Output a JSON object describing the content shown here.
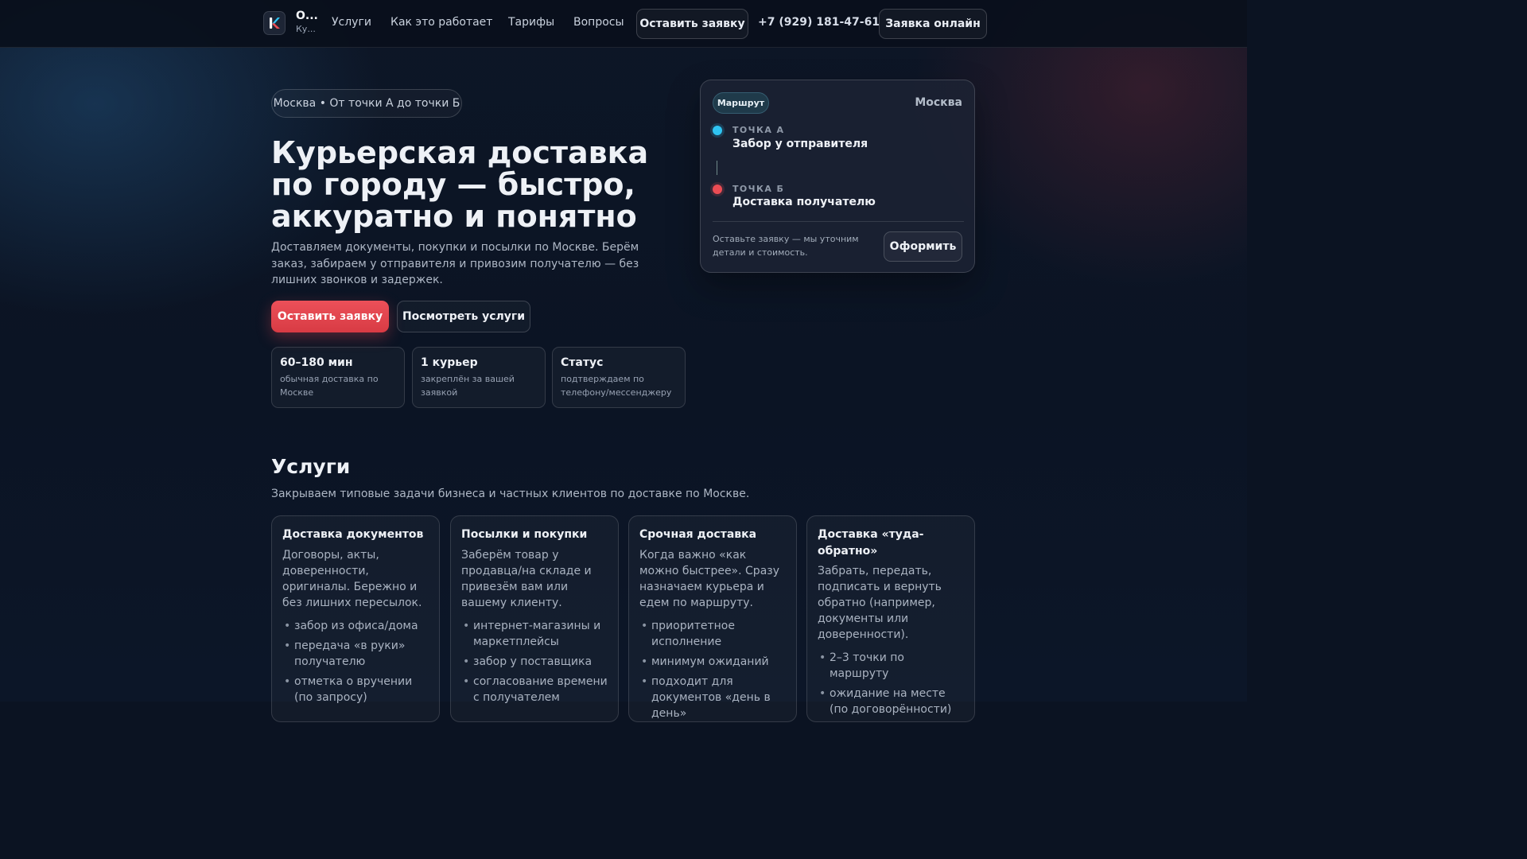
{
  "header": {
    "brand_title": "О...",
    "brand_subtitle": "Ку...",
    "logo_letter": "K",
    "nav": [
      "Услуги",
      "Как это работает",
      "Тарифы",
      "Вопросы"
    ],
    "request_button": "Оставить заявку",
    "phone": "+7 (929) 181-47-61",
    "online_button": "Заявка онлайн"
  },
  "hero": {
    "tag": "Москва • От точки А до точки Б",
    "title": "Курьерская доставка по городу — быстро, аккуратно и понятно",
    "description": "Доставляем документы, покупки и посылки по Москве. Берём заказ, забираем у отправителя и привозим получателю — без лишних звонков и задержек.",
    "primary_button": "Оставить заявку",
    "secondary_button": "Посмотреть услуги",
    "stats": [
      {
        "title": "60–180 мин",
        "subtitle": "обычная доставка по Москве"
      },
      {
        "title": "1 курьер",
        "subtitle": "закреплён за вашей заявкой"
      },
      {
        "title": "Статус",
        "subtitle": "подтверждаем по телефону/мессенджеру"
      }
    ]
  },
  "route": {
    "badge": "Маршрут",
    "city": "Москва",
    "point_a_label": "ТОЧКА А",
    "point_a_title": "Забор у отправителя",
    "point_b_label": "ТОЧКА Б",
    "point_b_title": "Доставка получателю",
    "note": "Оставьте заявку — мы уточним детали и стоимость.",
    "button": "Оформить",
    "colors": {
      "point_a": "#2fc4f2",
      "point_b": "#ec4c54"
    }
  },
  "services": {
    "title": "Услуги",
    "description": "Закрываем типовые задачи бизнеса и частных клиентов по доставке по Москве.",
    "cards": [
      {
        "title": "Доставка документов",
        "description": "Договоры, акты, доверенности, оригиналы. Бережно и без лишних пересылок.",
        "items": [
          "забор из офиса/дома",
          "передача «в руки» получателю",
          "отметка о вручении (по запросу)"
        ]
      },
      {
        "title": "Посылки и покупки",
        "description": "Заберём товар у продавца/на складе и привезём вам или вашему клиенту.",
        "items": [
          "интернет-магазины и маркетплейсы",
          "забор у поставщика",
          "согласование времени с получателем"
        ]
      },
      {
        "title": "Срочная доставка",
        "description": "Когда важно «как можно быстрее». Сразу назначаем курьера и едем по маршруту.",
        "items": [
          "приоритетное исполнение",
          "минимум ожиданий",
          "подходит для документов «день в день»"
        ]
      },
      {
        "title": "Доставка «туда-обратно»",
        "description": "Забрать, передать, подписать и вернуть обратно (например, документы или доверенности).",
        "items": [
          "2–3 точки по маршруту",
          "ожидание на месте (по договорённости)"
        ]
      }
    ]
  },
  "accent_colors": {
    "primary": "#e5464f",
    "background": "#0b1322"
  }
}
